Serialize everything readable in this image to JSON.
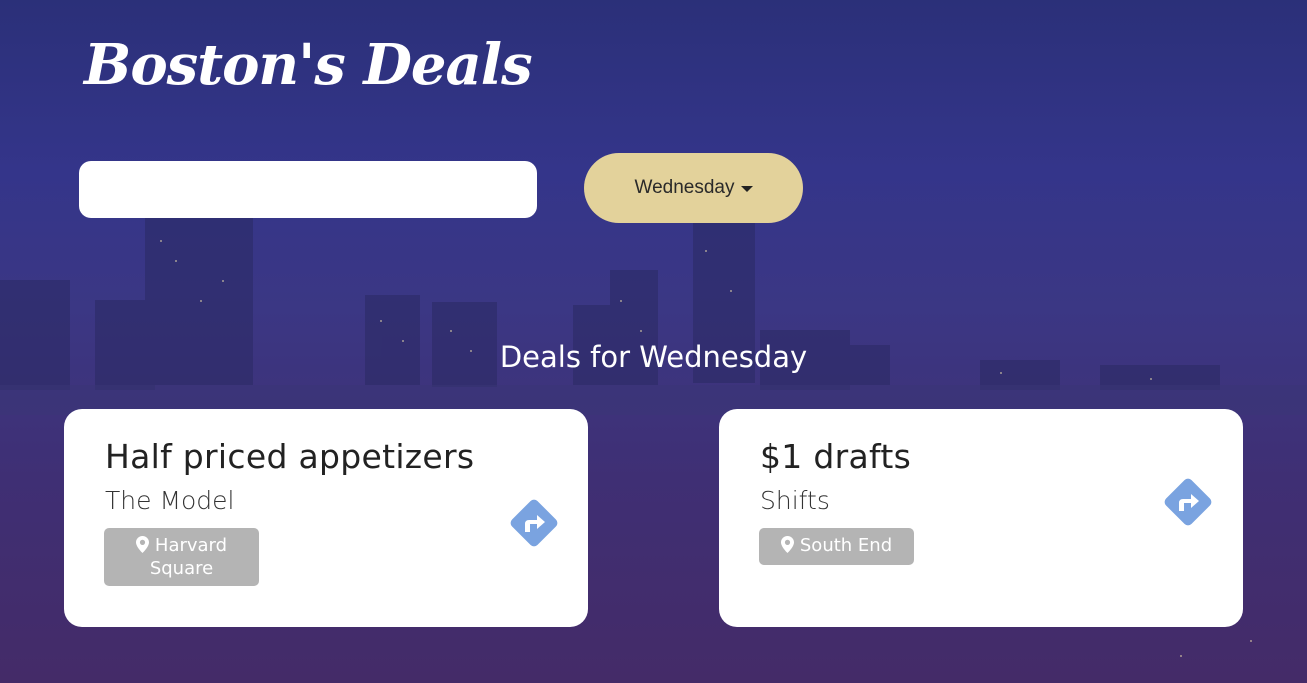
{
  "app": {
    "logo": "Boston's Deals"
  },
  "search": {
    "value": "",
    "placeholder": ""
  },
  "day_selector": {
    "selected": "Wednesday"
  },
  "section": {
    "title": "Deals for Wednesday"
  },
  "deals": [
    {
      "title": "Half priced appetizers",
      "venue": "The Model",
      "location_line1": "Harvard",
      "location_line2": "Square"
    },
    {
      "title": "$1 drafts",
      "venue": "Shifts",
      "location_line1": "South End",
      "location_line2": ""
    }
  ],
  "colors": {
    "accent_button": "#e3d29b",
    "directions_icon": "#7aa3e0",
    "location_tag": "#b4b4b4"
  },
  "icons": {
    "location": "map-pin-icon",
    "directions": "directions-icon",
    "dropdown": "caret-down-icon"
  }
}
